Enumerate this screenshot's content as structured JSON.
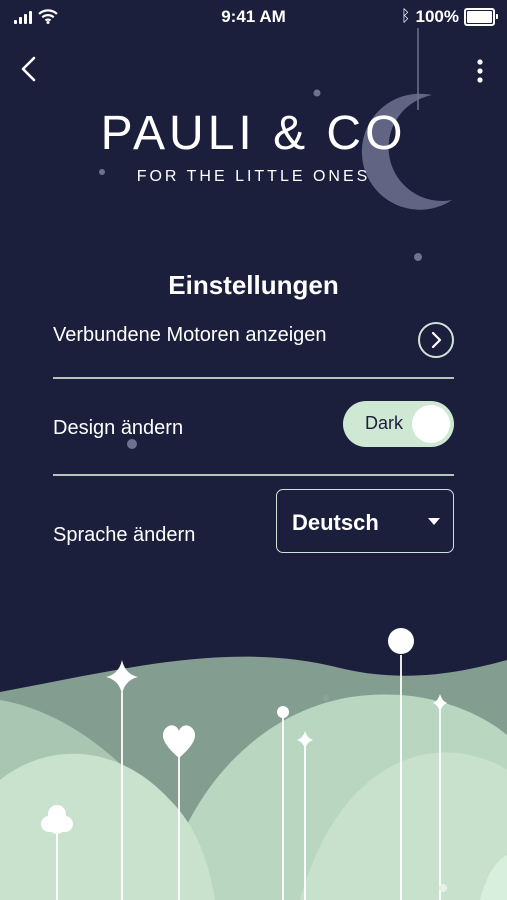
{
  "status_bar": {
    "time": "9:41 AM",
    "battery": "100%",
    "bluetooth_glyph": "ᛒ",
    "icons": [
      "signal-icon",
      "wifi-icon",
      "bluetooth-icon",
      "battery-icon"
    ]
  },
  "nav": {
    "back_icon": "chevron-left-icon",
    "menu_icon": "more-vertical-icon"
  },
  "brand": {
    "name": "PAULI & CO",
    "tagline": "FOR THE LITTLE ONES"
  },
  "settings": {
    "title": "Einstellungen",
    "motors_label": "Verbundene Motoren anzeigen",
    "design_label": "Design ändern",
    "design_toggle_value": "Dark",
    "language_label": "Sprache ändern",
    "language_value": "Deutsch"
  },
  "colors": {
    "background": "#1b1f3b",
    "accent": "#cfe8d3",
    "hills_light": "#b9d6c1",
    "hills_dark": "#8fab9b"
  }
}
